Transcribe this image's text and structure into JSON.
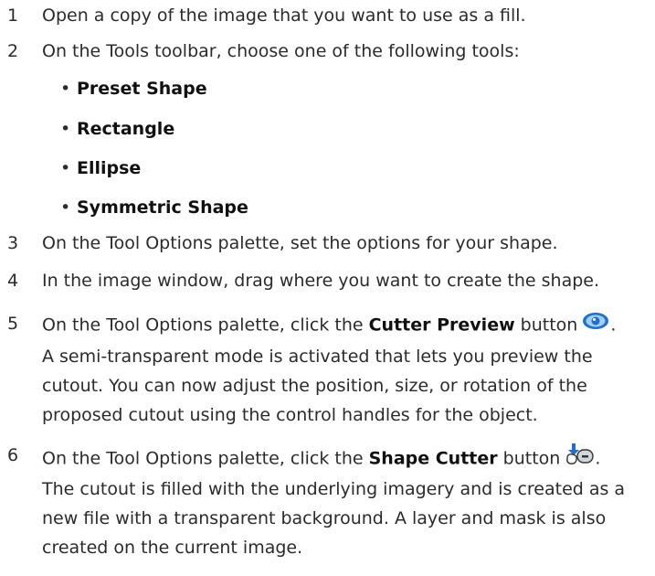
{
  "steps": [
    {
      "num": "1",
      "text": "Open a copy of the image that you want to use as a fill."
    },
    {
      "num": "2",
      "text": "On the Tools toolbar, choose one of the following tools:"
    },
    {
      "num": "3",
      "text": "On the Tool Options palette, set the options for your shape."
    },
    {
      "num": "4",
      "text": "In the image window, drag where you want to create the shape."
    },
    {
      "num": "5",
      "pre": "On the Tool Options palette, click the ",
      "bold": "Cutter Preview",
      "post": " button",
      "end": ".",
      "icon": "eye-icon"
    },
    {
      "num": "6",
      "pre": "On the Tool Options palette, click the ",
      "bold": "Shape Cutter",
      "post": " button",
      "end": ".",
      "icon": "shape-cutter-icon"
    }
  ],
  "tools": [
    "Preset Shape",
    "Rectangle",
    "Ellipse",
    "Symmetric Shape"
  ],
  "notes": {
    "step5": [
      "A semi-transparent mode is activated that lets you preview the",
      "cutout. You can now adjust the position, size, or rotation of the",
      "proposed cutout using the control handles for the object."
    ],
    "step6": [
      "The cutout is filled with the underlying imagery and is created as a",
      "new file with a transparent background. A layer and mask is also",
      "created on the current image."
    ]
  },
  "colors": {
    "icon_blue": "#1f6fd1",
    "icon_light": "#9fd0ff",
    "text": "#2b2b2b"
  }
}
